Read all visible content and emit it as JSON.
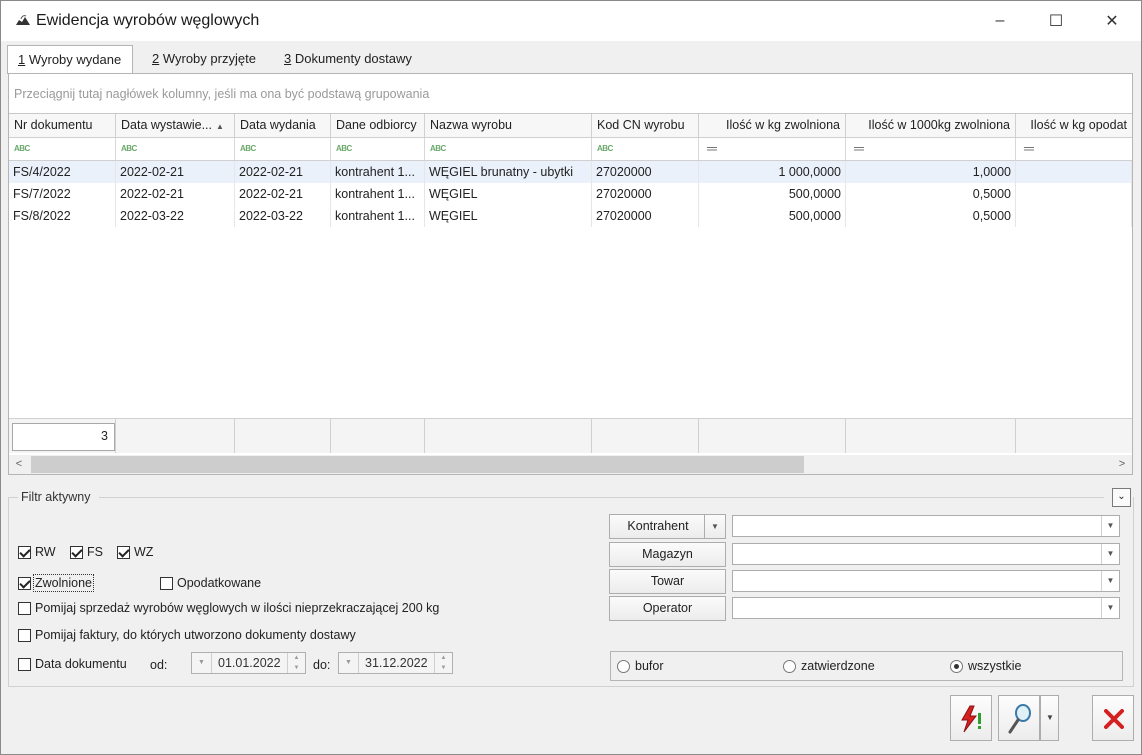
{
  "window": {
    "title": "Ewidencja wyrobów węglowych",
    "controls": {
      "minimize": "–",
      "maximize": "☐",
      "close": "✕"
    }
  },
  "tabs": [
    {
      "key": "1",
      "label": " Wyroby wydane"
    },
    {
      "key": "2",
      "label": " Wyroby przyjęte"
    },
    {
      "key": "3",
      "label": " Dokumenty dostawy"
    }
  ],
  "grid": {
    "group_hint": "Przeciągnij tutaj nagłówek kolumny, jeśli ma ona być podstawą grupowania",
    "columns": [
      "Nr dokumentu",
      "Data wystawie...",
      "Data wydania",
      "Dane odbiorcy",
      "Nazwa wyrobu",
      "Kod CN wyrobu",
      "Ilość w kg zwolniona",
      "Ilość w 1000kg zwolniona",
      "Ilość w kg opodat"
    ],
    "filter_glyphs": {
      "text": "ABC",
      "number": "═"
    },
    "rows": [
      [
        "FS/4/2022",
        "2022-02-21",
        "2022-02-21",
        "kontrahent 1...",
        "WĘGIEL brunatny - ubytki",
        "27020000",
        "1 000,0000",
        "1,0000",
        ""
      ],
      [
        "FS/7/2022",
        "2022-02-21",
        "2022-02-21",
        "kontrahent 1...",
        "WĘGIEL",
        "27020000",
        "500,0000",
        "0,5000",
        ""
      ],
      [
        "FS/8/2022",
        "2022-03-22",
        "2022-03-22",
        "kontrahent 1...",
        "WĘGIEL",
        "27020000",
        "500,0000",
        "0,5000",
        ""
      ]
    ],
    "selected_row": 0,
    "row_count": "3",
    "scroll": {
      "left": "<",
      "right": ">"
    }
  },
  "filter": {
    "legend": "Filtr aktywny",
    "collapse_glyph": "⌄",
    "doc_types": [
      {
        "label": "RW",
        "checked": true
      },
      {
        "label": "FS",
        "checked": true
      },
      {
        "label": "WZ",
        "checked": true
      }
    ],
    "zwolnione": {
      "label": "Zwolnione",
      "checked": true
    },
    "opodatkowane": {
      "label": "Opodatkowane",
      "checked": false
    },
    "pomijaj_200": {
      "label": "Pomijaj sprzedaż wyrobów węglowych w ilości nieprzekraczającej 200 kg",
      "checked": false
    },
    "pomijaj_faktury": {
      "label": "Pomijaj faktury, do których utworzono dokumenty dostawy",
      "checked": false
    },
    "data_dokumentu": {
      "label": "Data dokumentu",
      "checked": false
    },
    "od_label": "od:",
    "do_label": "do:",
    "date_from": "01.01.2022",
    "date_to": "31.12.2022",
    "kontrahent": {
      "label": "Kontrahent",
      "value": ""
    },
    "magazyn": {
      "label": "Magazyn",
      "value": ""
    },
    "towar": {
      "label": "Towar",
      "value": ""
    },
    "operator": {
      "label": "Operator",
      "value": ""
    },
    "status_radios": [
      {
        "label": "bufor",
        "selected": false
      },
      {
        "label": "zatwierdzone",
        "selected": false
      },
      {
        "label": "wszystkie",
        "selected": true
      }
    ]
  },
  "colors": {
    "selected_row": "#eaf1fb",
    "close_red": "#d42020",
    "refresh_green": "#2e9e2e"
  },
  "icons": [
    "app-icon",
    "refresh-filter-icon",
    "magnifier-icon",
    "close-x-icon"
  ]
}
